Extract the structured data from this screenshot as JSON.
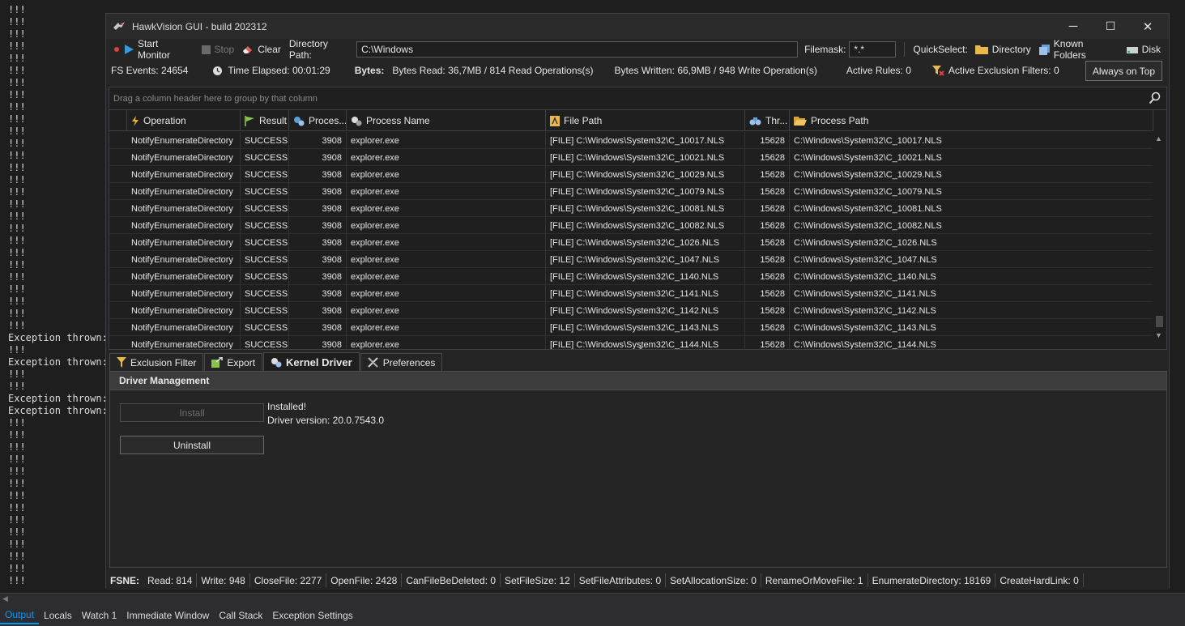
{
  "output": {
    "lines": [
      "!!!",
      "!!!",
      "!!!",
      "!!!",
      "!!!",
      "!!!",
      "!!!",
      "!!!",
      "!!!",
      "!!!",
      "!!!",
      "!!!",
      "!!!",
      "!!!",
      "!!!",
      "!!!",
      "!!!",
      "!!!",
      "!!!",
      "!!!",
      "!!!",
      "!!!",
      "!!!",
      "!!!",
      "!!!",
      "!!!",
      "!!!",
      "Exception thrown:",
      "!!!",
      "Exception thrown:",
      "!!!",
      "!!!",
      "Exception thrown:",
      "Exception thrown:",
      "!!!",
      "!!!",
      "!!!",
      "!!!",
      "!!!",
      "!!!",
      "!!!",
      "!!!",
      "!!!",
      "!!!",
      "!!!",
      "!!!",
      "!!!",
      "!!!"
    ]
  },
  "bottom_tabs": [
    "Output",
    "Locals",
    "Watch 1",
    "Immediate Window",
    "Call Stack",
    "Exception Settings"
  ],
  "window": {
    "title": "HawkVision GUI - build 202312",
    "minimize": "─",
    "maximize": "☐",
    "close": "✕"
  },
  "toolbar": {
    "start_label": "Start Monitor",
    "stop_label": "Stop",
    "clear_label": "Clear",
    "dir_label": "Directory Path:",
    "dir_value": "C:\\Windows",
    "mask_label": "Filemask:",
    "mask_value": "*.*",
    "quickselect_label": "QuickSelect:",
    "qs_directory": "Directory",
    "qs_known": "Known Folders",
    "qs_disk": "Disk"
  },
  "stats": {
    "fs_events": "FS Events: 24654",
    "elapsed": "Time Elapsed: 00:01:29",
    "bytes_label": "Bytes:",
    "bytes_read": "Bytes Read: 36,7MB / 814 Read Operations(s)",
    "bytes_written": "Bytes Written: 66,9MB / 948 Write Operation(s)",
    "active_rules": "Active Rules: 0",
    "exclusion_filters": "Active Exclusion Filters: 0",
    "always_on_top": "Always on Top"
  },
  "grid": {
    "group_hint": "Drag a column header here to group by that column",
    "columns": {
      "operation": "Operation",
      "result": "Result",
      "process_id": "Proces...",
      "process_name": "Process Name",
      "file_path": "File Path",
      "thread": "Thr...",
      "process_path": "Process Path"
    },
    "rows": [
      {
        "op": "NotifyEnumerateDirectory",
        "res": "SUCCESS",
        "pid": "3908",
        "pname": "explorer.exe",
        "fpath": "[FILE] C:\\Windows\\System32\\C_10017.NLS",
        "tid": "15628",
        "ppath": "C:\\Windows\\System32\\C_10017.NLS"
      },
      {
        "op": "NotifyEnumerateDirectory",
        "res": "SUCCESS",
        "pid": "3908",
        "pname": "explorer.exe",
        "fpath": "[FILE] C:\\Windows\\System32\\C_10021.NLS",
        "tid": "15628",
        "ppath": "C:\\Windows\\System32\\C_10021.NLS"
      },
      {
        "op": "NotifyEnumerateDirectory",
        "res": "SUCCESS",
        "pid": "3908",
        "pname": "explorer.exe",
        "fpath": "[FILE] C:\\Windows\\System32\\C_10029.NLS",
        "tid": "15628",
        "ppath": "C:\\Windows\\System32\\C_10029.NLS"
      },
      {
        "op": "NotifyEnumerateDirectory",
        "res": "SUCCESS",
        "pid": "3908",
        "pname": "explorer.exe",
        "fpath": "[FILE] C:\\Windows\\System32\\C_10079.NLS",
        "tid": "15628",
        "ppath": "C:\\Windows\\System32\\C_10079.NLS"
      },
      {
        "op": "NotifyEnumerateDirectory",
        "res": "SUCCESS",
        "pid": "3908",
        "pname": "explorer.exe",
        "fpath": "[FILE] C:\\Windows\\System32\\C_10081.NLS",
        "tid": "15628",
        "ppath": "C:\\Windows\\System32\\C_10081.NLS"
      },
      {
        "op": "NotifyEnumerateDirectory",
        "res": "SUCCESS",
        "pid": "3908",
        "pname": "explorer.exe",
        "fpath": "[FILE] C:\\Windows\\System32\\C_10082.NLS",
        "tid": "15628",
        "ppath": "C:\\Windows\\System32\\C_10082.NLS"
      },
      {
        "op": "NotifyEnumerateDirectory",
        "res": "SUCCESS",
        "pid": "3908",
        "pname": "explorer.exe",
        "fpath": "[FILE] C:\\Windows\\System32\\C_1026.NLS",
        "tid": "15628",
        "ppath": "C:\\Windows\\System32\\C_1026.NLS"
      },
      {
        "op": "NotifyEnumerateDirectory",
        "res": "SUCCESS",
        "pid": "3908",
        "pname": "explorer.exe",
        "fpath": "[FILE] C:\\Windows\\System32\\C_1047.NLS",
        "tid": "15628",
        "ppath": "C:\\Windows\\System32\\C_1047.NLS"
      },
      {
        "op": "NotifyEnumerateDirectory",
        "res": "SUCCESS",
        "pid": "3908",
        "pname": "explorer.exe",
        "fpath": "[FILE] C:\\Windows\\System32\\C_1140.NLS",
        "tid": "15628",
        "ppath": "C:\\Windows\\System32\\C_1140.NLS"
      },
      {
        "op": "NotifyEnumerateDirectory",
        "res": "SUCCESS",
        "pid": "3908",
        "pname": "explorer.exe",
        "fpath": "[FILE] C:\\Windows\\System32\\C_1141.NLS",
        "tid": "15628",
        "ppath": "C:\\Windows\\System32\\C_1141.NLS"
      },
      {
        "op": "NotifyEnumerateDirectory",
        "res": "SUCCESS",
        "pid": "3908",
        "pname": "explorer.exe",
        "fpath": "[FILE] C:\\Windows\\System32\\C_1142.NLS",
        "tid": "15628",
        "ppath": "C:\\Windows\\System32\\C_1142.NLS"
      },
      {
        "op": "NotifyEnumerateDirectory",
        "res": "SUCCESS",
        "pid": "3908",
        "pname": "explorer.exe",
        "fpath": "[FILE] C:\\Windows\\System32\\C_1143.NLS",
        "tid": "15628",
        "ppath": "C:\\Windows\\System32\\C_1143.NLS"
      },
      {
        "op": "NotifyEnumerateDirectory",
        "res": "SUCCESS",
        "pid": "3908",
        "pname": "explorer.exe",
        "fpath": "[FILE] C:\\Windows\\System32\\C_1144.NLS",
        "tid": "15628",
        "ppath": "C:\\Windows\\System32\\C_1144.NLS"
      }
    ]
  },
  "tabs": {
    "exclusion": "Exclusion Filter",
    "export": "Export",
    "kernel": "Kernel Driver",
    "preferences": "Preferences"
  },
  "driver": {
    "header": "Driver Management",
    "install_label": "Install",
    "uninstall_label": "Uninstall",
    "status_text": "Installed!",
    "version_text": "Driver version: 20.0.7543.0"
  },
  "status": {
    "label": "FSNE:",
    "items": [
      "Read: 814",
      "Write: 948",
      "CloseFile: 2277",
      "OpenFile: 2428",
      "CanFileBeDeleted: 0",
      "SetFileSize: 12",
      "SetFileAttributes: 0",
      "SetAllocationSize: 0",
      "RenameOrMoveFile: 1",
      "EnumerateDirectory: 18169",
      "CreateHardLink: 0"
    ]
  },
  "colors": {
    "background": "#1e1e1e",
    "window": "#252526",
    "accent": "#0097fb",
    "start_icon": "#3a96dd",
    "record_dot": "#e04040",
    "folder": "#e8b94a"
  }
}
